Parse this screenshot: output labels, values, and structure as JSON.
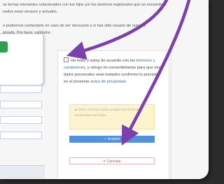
{
  "intro": {
    "line1": "se temas relevantes relacionados con tus hijos y/o los alumnos registrados que se encuentren",
    "line2": "nados sean veraces y actuales.",
    "line3": "e podremos contactarte en caso de ser necesario o si has sido usuario de nuestra",
    "line4": "istrado. Por favor, valídalos."
  },
  "consent": {
    "part1": "He leído y estoy de acuerdo con los",
    "terms_link": "términos y condiciones",
    "part2": ", y otorgo mi consentimiento para que mis datos personales sean tratados conforme lo previsto en el presente",
    "privacy_link": "aviso de privacidad",
    "end": "."
  },
  "warning": {
    "icon": "warning-icon",
    "text": "Para continuar debe aceptar los términos y condiciones del aviso."
  },
  "buttons": {
    "accept_label": "✓ Aceptar",
    "cancel_label": "✕ Cancelar"
  },
  "colors": {
    "arrow": "#7b3fae",
    "accept": "#4f93dc",
    "cancel": "#d05050",
    "warning_bg": "#fcf3cf",
    "link": "#2a6fc1"
  }
}
